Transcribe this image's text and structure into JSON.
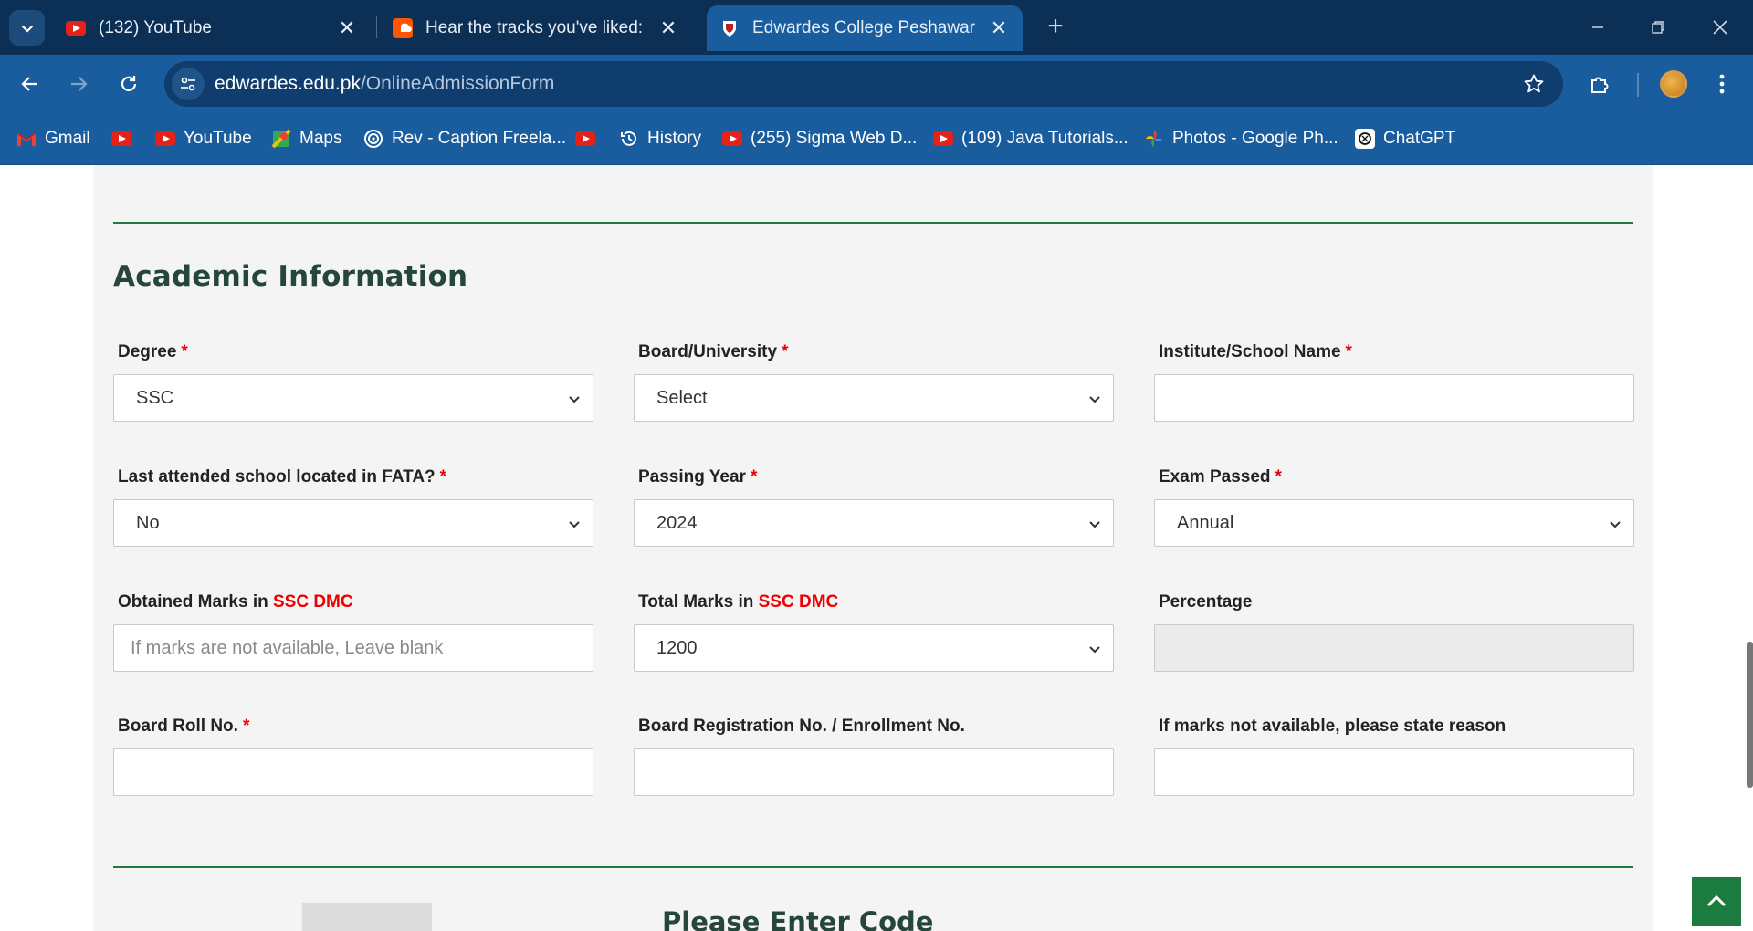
{
  "browser": {
    "tabs": [
      {
        "title": "(132) YouTube",
        "favicon": "youtube-icon"
      },
      {
        "title": "Hear the tracks you've liked: on",
        "favicon": "soundcloud-icon"
      },
      {
        "title": "Edwardes College Peshawar | EC",
        "favicon": "college-crest-icon"
      }
    ],
    "url_domain": "edwardes.edu.pk",
    "url_path": "/OnlineAdmissionForm",
    "bookmarks": [
      {
        "label": "Gmail",
        "icon": "gmail-icon"
      },
      {
        "label": "",
        "icon": "youtube-icon"
      },
      {
        "label": "YouTube",
        "icon": "youtube-icon"
      },
      {
        "label": "Maps",
        "icon": "maps-icon"
      },
      {
        "label": "Rev - Caption Freela...",
        "icon": "rev-icon"
      },
      {
        "label": "",
        "icon": "youtube-icon"
      },
      {
        "label": "History",
        "icon": "history-icon"
      },
      {
        "label": "(255) Sigma Web D...",
        "icon": "youtube-icon"
      },
      {
        "label": "(109) Java Tutorials...",
        "icon": "youtube-icon"
      },
      {
        "label": "Photos - Google Ph...",
        "icon": "google-photos-icon"
      },
      {
        "label": "ChatGPT",
        "icon": "chatgpt-icon"
      }
    ]
  },
  "form": {
    "section_title": "Academic Information",
    "degree": {
      "label": "Degree",
      "value": "SSC"
    },
    "board": {
      "label": "Board/University",
      "value": "Select"
    },
    "institute": {
      "label": "Institute/School Name",
      "value": ""
    },
    "fata": {
      "label": "Last attended school located in FATA?",
      "value": "No"
    },
    "passing_year": {
      "label": "Passing Year",
      "value": "2024"
    },
    "exam_passed": {
      "label": "Exam Passed",
      "value": "Annual"
    },
    "obtained_marks": {
      "label_prefix": "Obtained Marks in",
      "label_highlight": "SSC DMC",
      "placeholder": "If marks are not available, Leave blank"
    },
    "total_marks": {
      "label_prefix": "Total Marks in",
      "label_highlight": "SSC DMC",
      "value": "1200"
    },
    "percentage": {
      "label": "Percentage",
      "value": ""
    },
    "roll_no": {
      "label": "Board Roll No.",
      "value": ""
    },
    "registration_no": {
      "label": "Board Registration No. / Enrollment No.",
      "value": ""
    },
    "reason": {
      "label": "If marks not available, please state reason",
      "value": ""
    },
    "required_marker": "*",
    "code_title": "Please Enter Code"
  },
  "colors": {
    "accent_green": "#1f7a48",
    "required_red": "#e00000",
    "browser_blue": "#1a5d9e"
  }
}
